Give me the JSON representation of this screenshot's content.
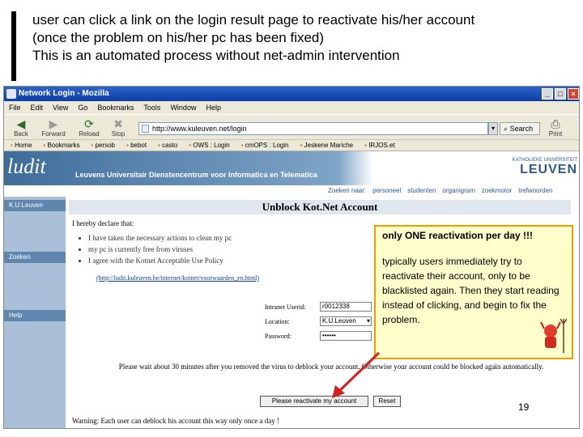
{
  "slide": {
    "lines": [
      "user can click a link on the login result page to reactivate his/her account",
      "(once the problem on his/her pc has been fixed)",
      "This is an automated process without net-admin intervention"
    ],
    "page_number": "19"
  },
  "browser": {
    "title": "Network Login - Mozilla",
    "window_buttons": [
      "_",
      "□",
      "×"
    ],
    "menu": [
      "File",
      "Edit",
      "View",
      "Go",
      "Bookmarks",
      "Tools",
      "Window",
      "Help"
    ],
    "toolbar": {
      "back": "Back",
      "forward": "Forward",
      "reload": "Reload",
      "stop": "Stop",
      "url": "http://www.kuleuven.net/login",
      "search": "Search",
      "print": "Print"
    },
    "bookmarks": [
      "Home",
      "Bookmarks",
      "persob",
      "bebot",
      "casto",
      "OWS : Login",
      "cmOPS : Login",
      "Jeskene Mariche",
      "IRJOS.et"
    ]
  },
  "page": {
    "logo": "ludit",
    "banner_text": "Leuvens Universitair Dienstencentrum voor Informatica en Telematica",
    "leuven_subtitle": "KATHOLIEKE UNIVERSITEIT",
    "leuven_title": "LEUVEN",
    "nav": [
      "Zoeken naar:",
      "personeel",
      "studenten",
      "organigram",
      "zoekmotor",
      "trefwoorden"
    ],
    "sidebar": [
      "K.U.Leuven",
      "Zoeken",
      "Help"
    ],
    "heading": "Unblock Kot.Net Account",
    "declare_intro": "I hereby declare that:",
    "declarations": [
      "I have taken the necessary actions to clean my pc",
      "my pc is currently free from viruses",
      "I agree with the Kotnet Acceptable Use Policy"
    ],
    "policy_link": "(http://ludit.kuleuven.be/internet/kotnet/voorwaarden_en.html)",
    "form": {
      "userid_label": "Intranet Userid:",
      "userid_value": "r0012338",
      "location_label": "Location:",
      "location_value": "K.U.Leuven",
      "password_label": "Password:",
      "password_value": "••••••"
    },
    "notice": "Please wait about 30 minutes after you removed the virus to deblock your account. Otherwise your account could be blocked again automatically.",
    "reactivate_button": "Please reactivate my account",
    "reset_button": "Reset",
    "warning": "Warning: Each user can deblock his account this way only once a day !"
  },
  "callout": {
    "title": "only ONE reactivation per day !!!",
    "body": "typically users immediately try to reactivate their account, only to be blacklisted again. Then they start reading instead of clicking, and begin to fix the problem."
  },
  "colors": {
    "callout_border": "#e8a000",
    "callout_bg": "#ffffcc",
    "arrow": "#d42020"
  }
}
